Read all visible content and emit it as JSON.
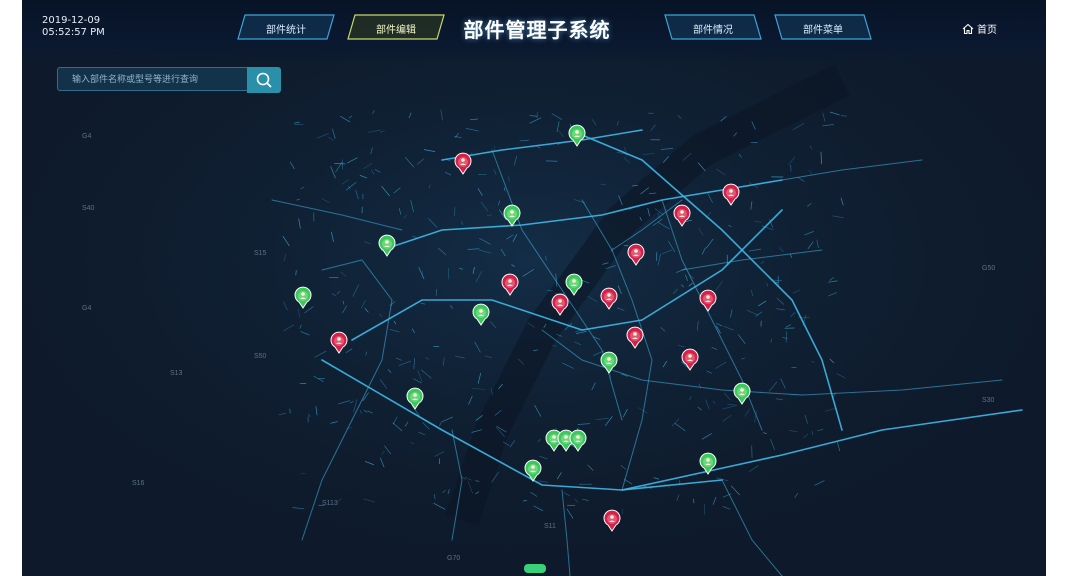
{
  "header": {
    "date": "2019-12-09",
    "time": "05:52:57 PM",
    "title": "部件管理子系统",
    "home_label": "首页"
  },
  "nav": {
    "tabs": [
      {
        "label": "部件统计",
        "active": false
      },
      {
        "label": "部件编辑",
        "active": true
      },
      {
        "label": "部件情况",
        "active": false
      },
      {
        "label": "部件菜单",
        "active": false
      }
    ]
  },
  "search": {
    "placeholder": "输入部件名称或型号等进行查询",
    "value": ""
  },
  "map": {
    "road_labels": [
      "G4",
      "S40",
      "S15",
      "G4",
      "S50",
      "S13",
      "S113",
      "S11",
      "G70",
      "S30",
      "G50",
      "S16"
    ],
    "markers": {
      "green_count": 14,
      "red_count": 12
    }
  },
  "colors": {
    "background": "#0e1a2b",
    "road": "#3fb8e8",
    "marker_green": "#3cc95c",
    "marker_red": "#d6204a",
    "active_tab": "#c8d86a",
    "tab_border": "#3aa6d6"
  },
  "icons": {
    "home": "home-icon",
    "search": "search-icon"
  }
}
